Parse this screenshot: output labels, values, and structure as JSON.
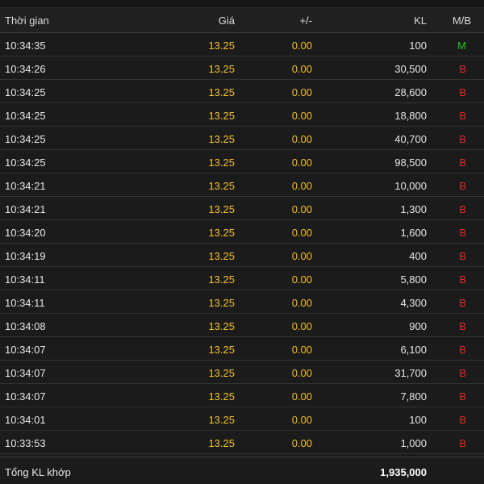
{
  "header": {
    "time_label": "Thời gian",
    "price_label": "Giá",
    "change_label": "+/-",
    "volume_label": "KL",
    "side_label": "M/B"
  },
  "colors": {
    "price": "#f2c12e",
    "buy_M": "#20c020",
    "sell_B": "#e02828",
    "background": "#1b1b1b"
  },
  "trades": [
    {
      "time": "10:34:35",
      "price": "13.25",
      "change": "0.00",
      "volume": "100",
      "side": "M"
    },
    {
      "time": "10:34:26",
      "price": "13.25",
      "change": "0.00",
      "volume": "30,500",
      "side": "B"
    },
    {
      "time": "10:34:25",
      "price": "13.25",
      "change": "0.00",
      "volume": "28,600",
      "side": "B"
    },
    {
      "time": "10:34:25",
      "price": "13.25",
      "change": "0.00",
      "volume": "18,800",
      "side": "B"
    },
    {
      "time": "10:34:25",
      "price": "13.25",
      "change": "0.00",
      "volume": "40,700",
      "side": "B"
    },
    {
      "time": "10:34:25",
      "price": "13.25",
      "change": "0.00",
      "volume": "98,500",
      "side": "B"
    },
    {
      "time": "10:34:21",
      "price": "13.25",
      "change": "0.00",
      "volume": "10,000",
      "side": "B"
    },
    {
      "time": "10:34:21",
      "price": "13.25",
      "change": "0.00",
      "volume": "1,300",
      "side": "B"
    },
    {
      "time": "10:34:20",
      "price": "13.25",
      "change": "0.00",
      "volume": "1,600",
      "side": "B"
    },
    {
      "time": "10:34:19",
      "price": "13.25",
      "change": "0.00",
      "volume": "400",
      "side": "B"
    },
    {
      "time": "10:34:11",
      "price": "13.25",
      "change": "0.00",
      "volume": "5,800",
      "side": "B"
    },
    {
      "time": "10:34:11",
      "price": "13.25",
      "change": "0.00",
      "volume": "4,300",
      "side": "B"
    },
    {
      "time": "10:34:08",
      "price": "13.25",
      "change": "0.00",
      "volume": "900",
      "side": "B"
    },
    {
      "time": "10:34:07",
      "price": "13.25",
      "change": "0.00",
      "volume": "6,100",
      "side": "B"
    },
    {
      "time": "10:34:07",
      "price": "13.25",
      "change": "0.00",
      "volume": "31,700",
      "side": "B"
    },
    {
      "time": "10:34:07",
      "price": "13.25",
      "change": "0.00",
      "volume": "7,800",
      "side": "B"
    },
    {
      "time": "10:34:01",
      "price": "13.25",
      "change": "0.00",
      "volume": "100",
      "side": "B"
    },
    {
      "time": "10:33:53",
      "price": "13.25",
      "change": "0.00",
      "volume": "1,000",
      "side": "B"
    }
  ],
  "footer": {
    "total_label": "Tổng KL khớp",
    "total_value": "1,935,000"
  }
}
